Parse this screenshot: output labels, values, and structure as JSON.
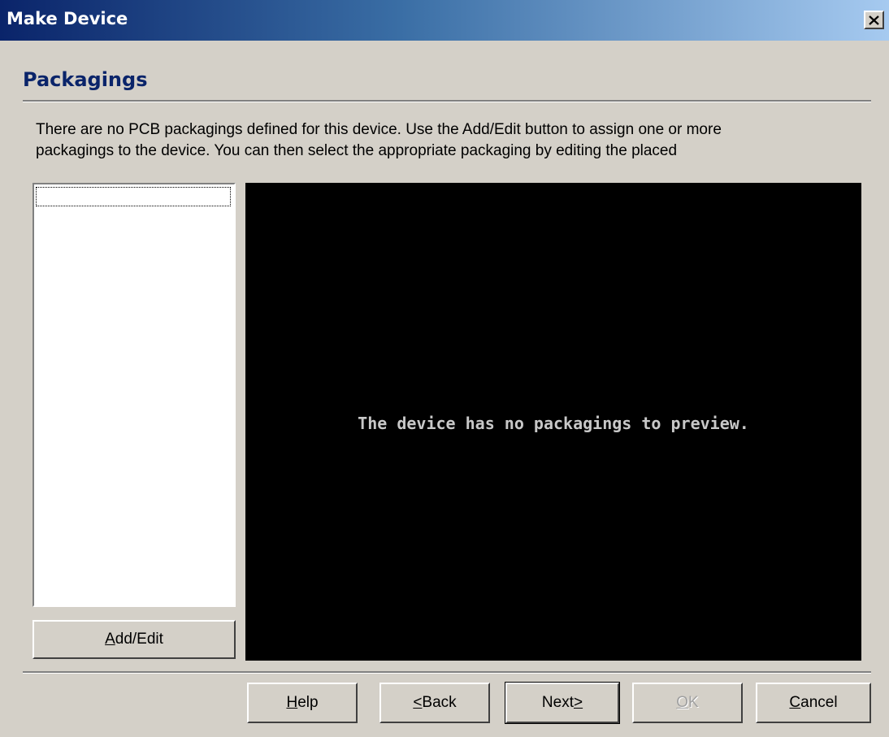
{
  "window": {
    "title": "Make Device",
    "close_icon": "×"
  },
  "page": {
    "heading": "Packagings",
    "description_line1": "There are no PCB packagings defined for this device. Use the Add/Edit button to assign one or more",
    "description_line2": "packagings to the device. You can then select the appropriate packaging by editing the placed"
  },
  "packaging_list": {
    "items": []
  },
  "add_edit_button": {
    "mnemonic": "A",
    "rest": "dd/Edit"
  },
  "preview": {
    "message": "The device has no packagings to preview.",
    "background": "#000000"
  },
  "footer": {
    "help": {
      "mnemonic": "H",
      "rest": "elp"
    },
    "back": {
      "pre": "",
      "mnemonic": "<",
      "rest": "Back"
    },
    "next": {
      "pre": "Next",
      "mnemonic": ">",
      "rest": ""
    },
    "ok": {
      "mnemonic": "O",
      "rest": "K",
      "enabled": false
    },
    "cancel": {
      "mnemonic": "C",
      "rest": "ancel"
    }
  },
  "colors": {
    "dialog_face": "#d4d0c8",
    "title_gradient_start": "#0a246a",
    "title_gradient_end": "#a6caf0",
    "heading": "#0a246a"
  }
}
